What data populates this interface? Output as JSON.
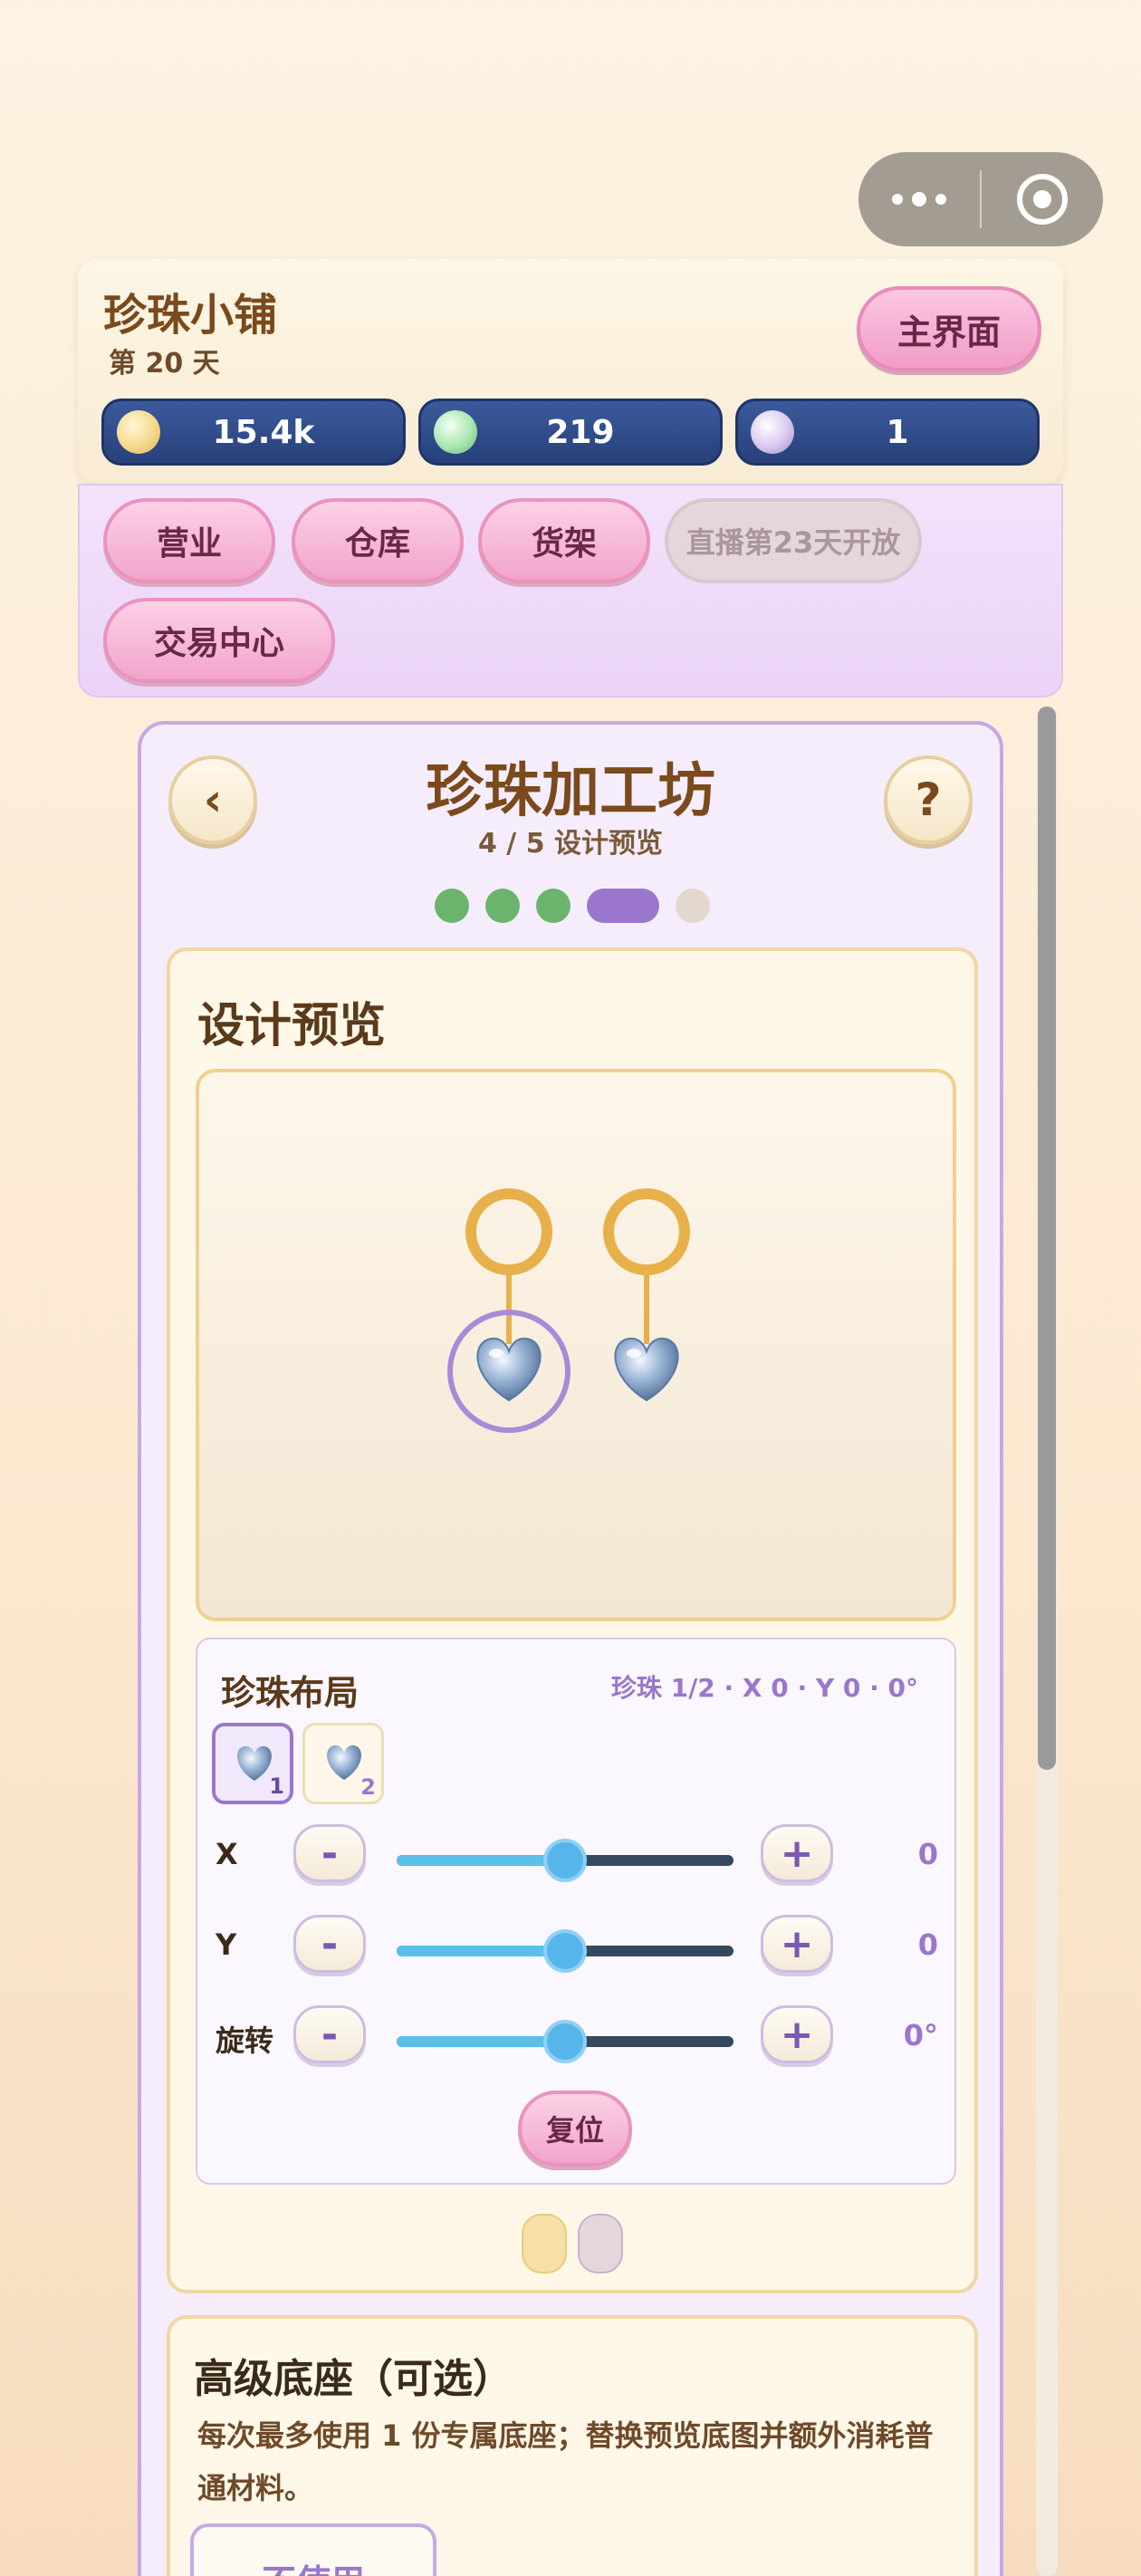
{
  "shop": {
    "title": "珍珠小铺",
    "day": "第 20 天",
    "main_button": "主界面",
    "resources": [
      {
        "icon": "gold-coin-icon",
        "value": "15.4k",
        "color": "#f6d98a"
      },
      {
        "icon": "green-pearl-icon",
        "value": "219",
        "color": "#a8e6b0"
      },
      {
        "icon": "purple-pearl-icon",
        "value": "1",
        "color": "#d8c8f0"
      }
    ]
  },
  "nav": {
    "items": [
      {
        "label": "营业",
        "enabled": true
      },
      {
        "label": "仓库",
        "enabled": true
      },
      {
        "label": "货架",
        "enabled": true
      },
      {
        "label": "直播第23天开放",
        "enabled": false
      },
      {
        "label": "交易中心",
        "enabled": true
      }
    ]
  },
  "workshop": {
    "back_icon": "‹",
    "help_icon": "?",
    "title": "珍珠加工坊",
    "step": "4 / 5  设计预览",
    "progress": {
      "current": 4,
      "total": 5
    }
  },
  "design": {
    "title": "设计预览",
    "layout": {
      "title": "珍珠布局",
      "info": "珍珠 1/2 · X 0 · Y 0 · 0°",
      "thumbs": [
        {
          "num": "1",
          "selected": true
        },
        {
          "num": "2",
          "selected": false
        }
      ],
      "rows": [
        {
          "label": "X",
          "minus": "-",
          "plus": "+",
          "value": "0",
          "level": 0.5
        },
        {
          "label": "Y",
          "minus": "-",
          "plus": "+",
          "value": "0",
          "level": 0.5
        },
        {
          "label": "旋转",
          "minus": "-",
          "plus": "+",
          "value": "0°",
          "level": 0.5
        }
      ],
      "reset": "复位"
    },
    "pages": {
      "current": 1,
      "total": 2
    }
  },
  "base": {
    "title": "高级底座（可选）",
    "desc": "每次最多使用 1 份专属底座；替换预览底图并额外消耗普通材料。",
    "no_use": "不使用"
  },
  "colors": {
    "accent_purple": "#9a77cc",
    "gold_ring": "#e8b04a",
    "progress_done": "#6bb46d"
  }
}
